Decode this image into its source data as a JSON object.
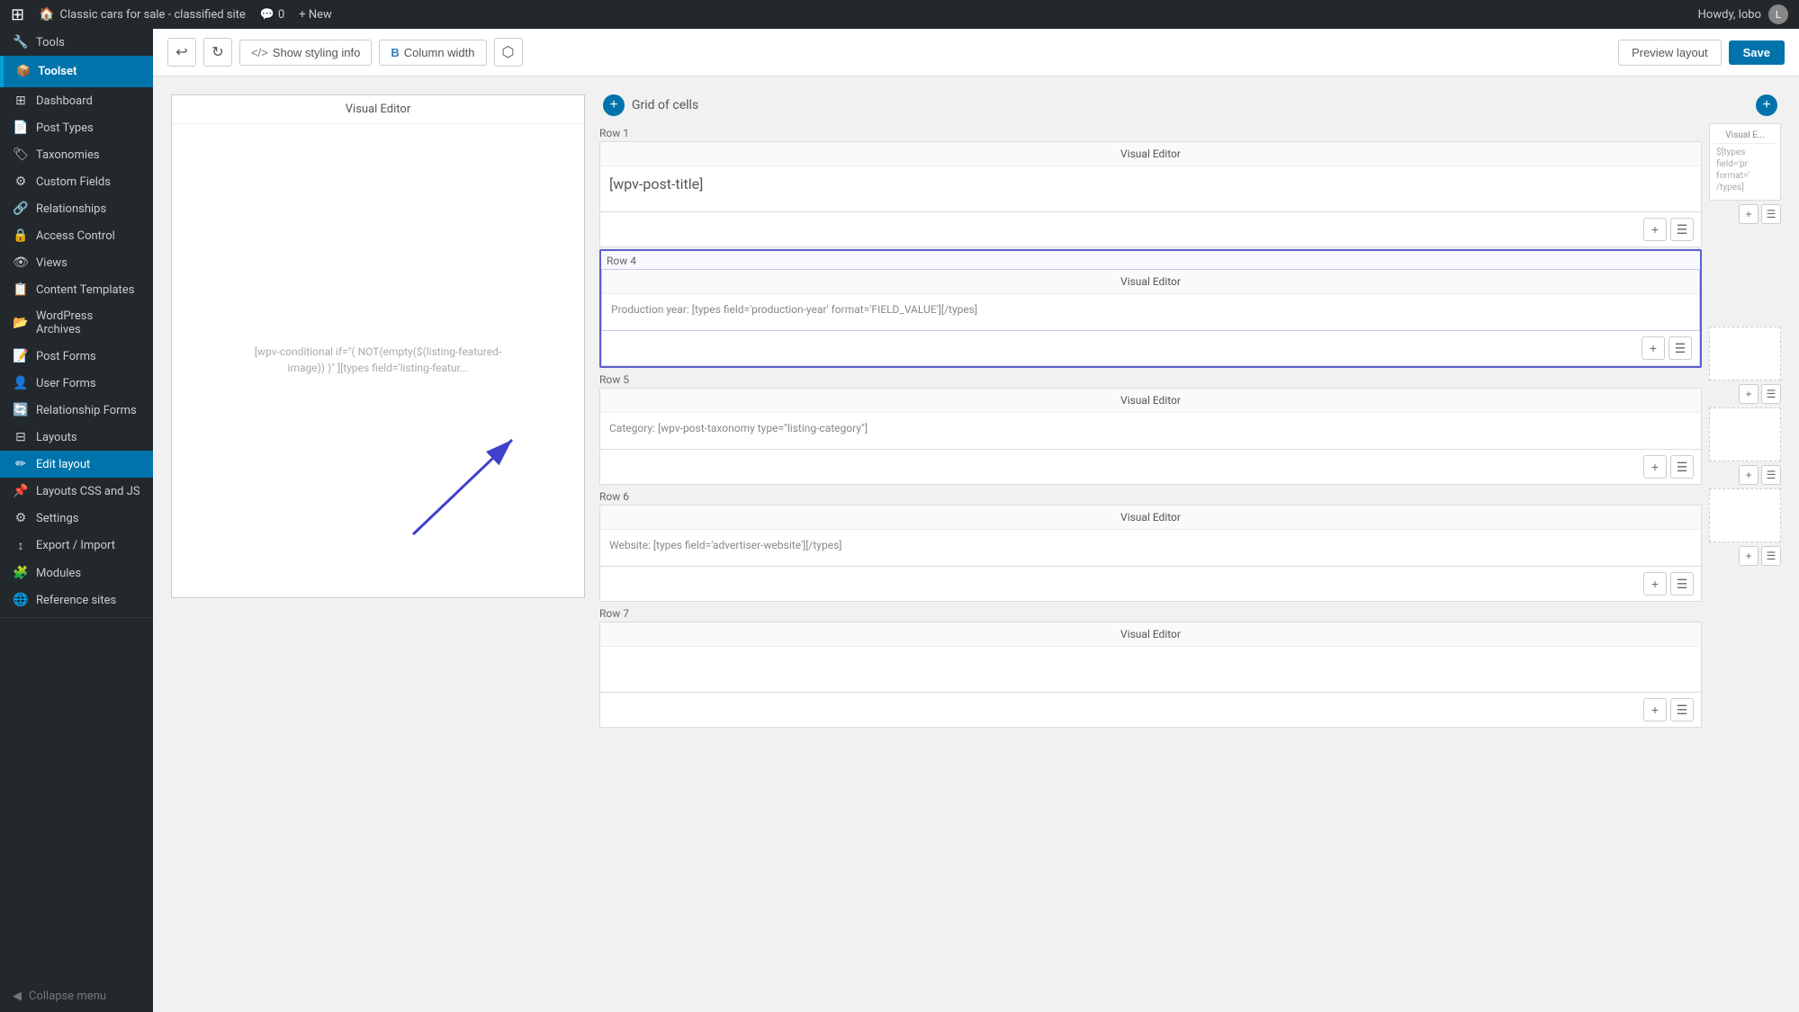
{
  "admin_bar": {
    "logo": "W",
    "site_name": "Classic cars for sale - classified site",
    "comments_label": "Comments",
    "comments_count": "0",
    "new_label": "+ New",
    "howdy": "Howdy, lobo",
    "avatar_initials": "L"
  },
  "sidebar": {
    "tools_label": "Tools",
    "toolset_label": "Toolset",
    "items": [
      {
        "id": "dashboard",
        "label": "Dashboard",
        "icon": "⊞"
      },
      {
        "id": "post-types",
        "label": "Post Types",
        "icon": "📄"
      },
      {
        "id": "taxonomies",
        "label": "Taxonomies",
        "icon": "🏷"
      },
      {
        "id": "custom-fields",
        "label": "Custom Fields",
        "icon": "⚙"
      },
      {
        "id": "relationships",
        "label": "Relationships",
        "icon": "🔗"
      },
      {
        "id": "access-control",
        "label": "Access Control",
        "icon": "🔒"
      },
      {
        "id": "views",
        "label": "Views",
        "icon": "👁"
      },
      {
        "id": "content-templates",
        "label": "Content Templates",
        "icon": "📋"
      },
      {
        "id": "wordpress-archives",
        "label": "WordPress Archives",
        "icon": "📂"
      },
      {
        "id": "post-forms",
        "label": "Post Forms",
        "icon": "📝"
      },
      {
        "id": "user-forms",
        "label": "User Forms",
        "icon": "👤"
      },
      {
        "id": "relationship-forms",
        "label": "Relationship Forms",
        "icon": "🔄"
      },
      {
        "id": "layouts",
        "label": "Layouts",
        "icon": "⊟"
      },
      {
        "id": "edit-layout",
        "label": "Edit layout",
        "icon": "✏"
      },
      {
        "id": "layouts-css-js",
        "label": "Layouts CSS and JS",
        "icon": "📌"
      },
      {
        "id": "settings",
        "label": "Settings",
        "icon": "⚙"
      },
      {
        "id": "export-import",
        "label": "Export / Import",
        "icon": "↕"
      },
      {
        "id": "modules",
        "label": "Modules",
        "icon": "🧩"
      },
      {
        "id": "reference-sites",
        "label": "Reference sites",
        "icon": "🌐"
      }
    ],
    "collapse_label": "Collapse menu"
  },
  "toolbar": {
    "undo_label": "↩",
    "redo_label": "↻",
    "show_styling_label": "Show styling info",
    "column_width_label": "Column width",
    "export_icon": "⬜",
    "preview_label": "Preview layout",
    "save_label": "Save"
  },
  "grid": {
    "title": "Grid of cells",
    "row1": {
      "label": "Row 1",
      "main_cell": {
        "header": "Visual Editor",
        "content": "[wpv-post-title]"
      },
      "side_cell": {
        "header": "Visual E...",
        "content": "$[types field='pr format=' /types]"
      }
    },
    "row4": {
      "label": "Row 4",
      "main_cell": {
        "header": "Visual Editor",
        "content": "Production year: [types field='production-year' format='FIELD_VALUE'][/types]"
      }
    },
    "row5": {
      "label": "Row 5",
      "main_cell": {
        "header": "Visual Editor",
        "content": "Category: [wpv-post-taxonomy type=\"listing-category\"]"
      }
    },
    "row6": {
      "label": "Row 6",
      "main_cell": {
        "header": "Visual Editor",
        "content": "Website: [types field='advertiser-website'][/types]"
      }
    },
    "row7": {
      "label": "Row 7",
      "main_cell": {
        "header": "Visual Editor",
        "content": ""
      }
    }
  },
  "left_panel": {
    "header": "Visual Editor",
    "content": "[wpv-conditional if=\"( NOT(empty($(listing-featured-image)) )\" ][types field='listing-featur..."
  }
}
